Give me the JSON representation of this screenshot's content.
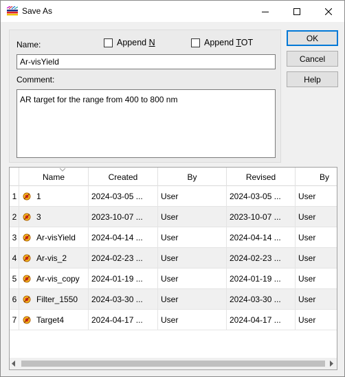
{
  "window": {
    "title": "Save As",
    "icons": {
      "app": "color-bars-icon",
      "minimize": "minimize-icon",
      "maximize": "maximize-icon",
      "close": "close-icon"
    }
  },
  "form": {
    "name_label": "Name:",
    "name_value": "Ar-visYield",
    "append_n": {
      "prefix": "Append ",
      "underlined": "N",
      "suffix": "",
      "checked": false
    },
    "append_tot": {
      "prefix": "Append ",
      "underlined": "T",
      "suffix": "OT",
      "checked": false
    },
    "comment_label": "Comment:",
    "comment_value": "AR target for the range from 400 to 800 nm"
  },
  "buttons": {
    "ok": "OK",
    "cancel": "Cancel",
    "help": "Help"
  },
  "table": {
    "columns": [
      "Name",
      "Created",
      "By",
      "Revised",
      "By"
    ],
    "sorted_column": "Name",
    "rows": [
      {
        "num": "1",
        "name": "1",
        "created": "2024-03-05 ...",
        "by": "User",
        "revised": "2024-03-05 ...",
        "by2": "User"
      },
      {
        "num": "2",
        "name": "3",
        "created": "2023-10-07 ...",
        "by": "User",
        "revised": "2023-10-07 ...",
        "by2": "User"
      },
      {
        "num": "3",
        "name": "Ar-visYield",
        "created": "2024-04-14 ...",
        "by": "User",
        "revised": "2024-04-14 ...",
        "by2": "User"
      },
      {
        "num": "4",
        "name": "Ar-vis_2",
        "created": "2024-02-23 ...",
        "by": "User",
        "revised": "2024-02-23 ...",
        "by2": "User"
      },
      {
        "num": "5",
        "name": "Ar-vis_copy",
        "created": "2024-01-19 ...",
        "by": "User",
        "revised": "2024-01-19 ...",
        "by2": "User"
      },
      {
        "num": "6",
        "name": "Filter_1550",
        "created": "2024-03-30 ...",
        "by": "User",
        "revised": "2024-03-30 ...",
        "by2": "User"
      },
      {
        "num": "7",
        "name": "Target4",
        "created": "2024-04-17 ...",
        "by": "User",
        "revised": "2024-04-17 ...",
        "by2": "User"
      }
    ],
    "row_icon": "target-icon"
  },
  "colors": {
    "accent": "#0078d7",
    "row_alt": "#f0f0f0",
    "panel": "#ebebeb"
  }
}
